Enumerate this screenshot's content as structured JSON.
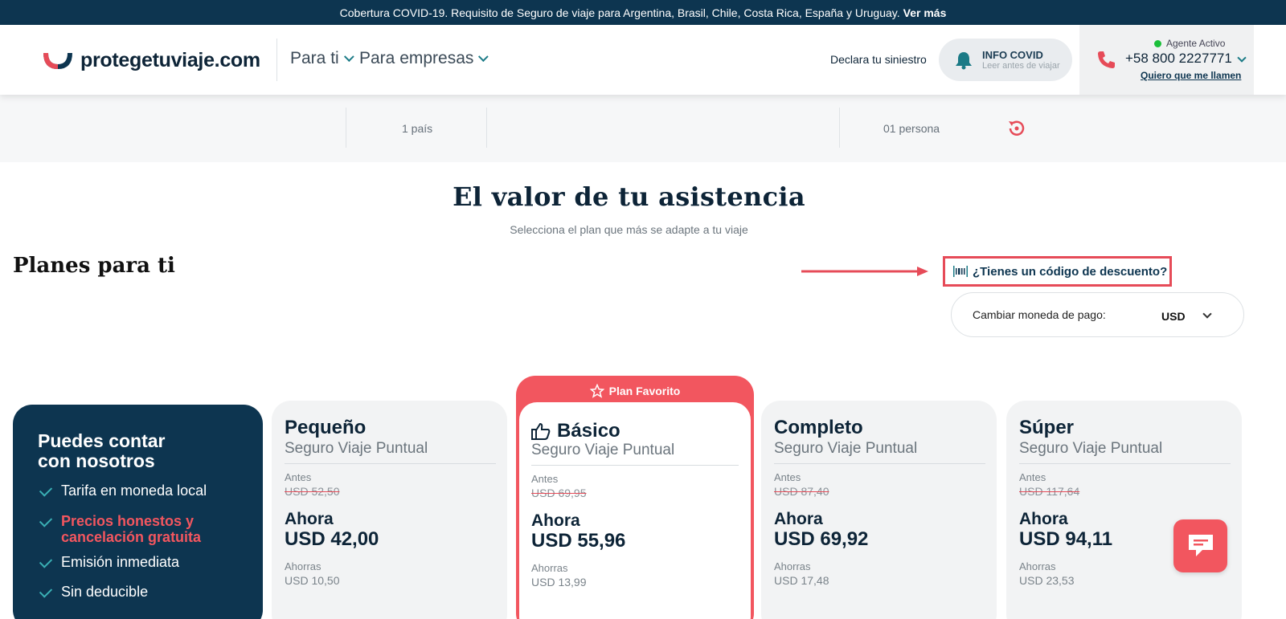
{
  "banner": {
    "text": "Cobertura COVID-19. Requisito de Seguro de viaje para Argentina, Brasil, Chile, Costa Rica, España y Uruguay.",
    "link": "Ver más"
  },
  "header": {
    "logo_text": "protegetuviaje.com",
    "nav": [
      {
        "label": "Para ti"
      },
      {
        "label": "Para empresas"
      }
    ],
    "declara": "Declara tu siniestro",
    "infocovid": {
      "title": "INFO COVID",
      "subtitle": "Leer antes de viajar"
    },
    "agent_status": "Agente Activo",
    "phone": "+58 800 2227771",
    "callback": "Quiero que me llamen"
  },
  "summary": {
    "countries": "1 país",
    "people": "01 persona"
  },
  "main": {
    "title": "El valor de tu asistencia",
    "subtitle": "Selecciona el plan que más se adapte a tu viaje",
    "plans_title": "Planes para ti",
    "discount_link": "¿Tienes un código de descuento?",
    "currency_label": "Cambiar moneda de pago:",
    "currency_value": "USD"
  },
  "info_card": {
    "heading": "Puedes contar con nosotros",
    "items": [
      "Tarifa en moneda local",
      "Precios honestos y cancelación gratuita",
      "Emisión inmediata",
      "Sin deducible"
    ]
  },
  "plans": [
    {
      "name": "Pequeño",
      "type": "Seguro Viaje Puntual",
      "antes_label": "Antes",
      "old_price": "USD 52,50",
      "ahora_label": "Ahora",
      "price": "USD 42,00",
      "ahorras_label": "Ahorras",
      "savings": "USD 10,50"
    },
    {
      "name": "Básico",
      "type": "Seguro Viaje Puntual",
      "antes_label": "Antes",
      "old_price": "USD 69,95",
      "ahora_label": "Ahora",
      "price": "USD 55,96",
      "ahorras_label": "Ahorras",
      "savings": "USD 13,99",
      "ribbon": "Plan Favorito"
    },
    {
      "name": "Completo",
      "type": "Seguro Viaje Puntual",
      "antes_label": "Antes",
      "old_price": "USD 87,40",
      "ahora_label": "Ahora",
      "price": "USD 69,92",
      "ahorras_label": "Ahorras",
      "savings": "USD 17,48"
    },
    {
      "name": "Súper",
      "type": "Seguro Viaje Puntual",
      "antes_label": "Antes",
      "old_price": "USD 117,64",
      "ahora_label": "Ahora",
      "price": "USD 94,11",
      "ahorras_label": "Ahorras",
      "savings": "USD 23,53"
    }
  ],
  "colors": {
    "navy": "#0d3550",
    "accent": "#f2565f",
    "highlight_box": "#e64b58",
    "teal": "#1a7a86"
  },
  "icons": [
    "chevron-down-icon",
    "bell-icon",
    "phone-icon",
    "reset-icon",
    "barcode-icon",
    "check-icon",
    "star-icon",
    "thumbs-up-icon",
    "chat-icon",
    "arrow-right-icon"
  ]
}
